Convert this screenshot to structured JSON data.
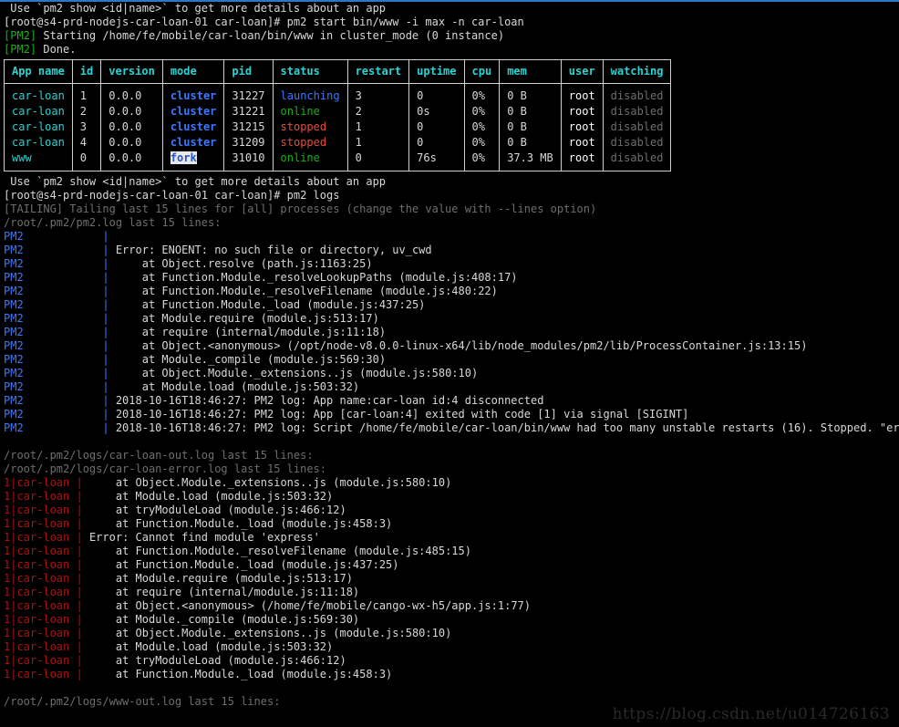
{
  "terminal": {
    "hint_line": " Use `pm2 show <id|name>` to get more details about an app",
    "prompt_1_user": "[root@s4-prd-nodejs-car-loan-01 car-loan]#",
    "prompt_1_cmd": " pm2 start bin/www -i max -n car-loan",
    "pm2_tag": "[PM2]",
    "starting_text": " Starting /home/fe/mobile/car-loan/bin/www in cluster_mode (0 instance)",
    "done_text": " Done.",
    "hint_line_2": " Use `pm2 show <id|name>` to get more details about an app",
    "prompt_2_user": "[root@s4-prd-nodejs-car-loan-01 car-loan]#",
    "prompt_2_cmd": " pm2 logs",
    "tailing_line": "[TAILING] Tailing last 15 lines for [all] processes (change the value with --lines option)",
    "pm2log_header": "/root/.pm2/pm2.log last 15 lines:",
    "carloan_out_header": "/root/.pm2/logs/car-loan-out.log last 15 lines:",
    "carloan_err_header": "/root/.pm2/logs/car-loan-error.log last 15 lines:",
    "www_out_header": "/root/.pm2/logs/www-out.log last 15 lines:"
  },
  "table": {
    "headers": [
      "App name",
      "id",
      "version",
      "mode",
      "pid",
      "status",
      "restart",
      "uptime",
      "cpu",
      "mem",
      "user",
      "watching"
    ],
    "rows": [
      {
        "app": "car-loan",
        "id": "1",
        "version": "0.0.0",
        "mode": "cluster",
        "mode_selected": false,
        "pid": "31227",
        "status": "launching",
        "status_kind": "launching",
        "restart": "3",
        "uptime": "0",
        "cpu": "0%",
        "mem": "0 B",
        "user": "root",
        "watching": "disabled"
      },
      {
        "app": "car-loan",
        "id": "2",
        "version": "0.0.0",
        "mode": "cluster",
        "mode_selected": false,
        "pid": "31221",
        "status": "online",
        "status_kind": "online",
        "restart": "2",
        "uptime": "0s",
        "cpu": "0%",
        "mem": "0 B",
        "user": "root",
        "watching": "disabled"
      },
      {
        "app": "car-loan",
        "id": "3",
        "version": "0.0.0",
        "mode": "cluster",
        "mode_selected": false,
        "pid": "31215",
        "status": "stopped",
        "status_kind": "stopped",
        "restart": "1",
        "uptime": "0",
        "cpu": "0%",
        "mem": "0 B",
        "user": "root",
        "watching": "disabled"
      },
      {
        "app": "car-loan",
        "id": "4",
        "version": "0.0.0",
        "mode": "cluster",
        "mode_selected": false,
        "pid": "31209",
        "status": "stopped",
        "status_kind": "stopped",
        "restart": "1",
        "uptime": "0",
        "cpu": "0%",
        "mem": "0 B",
        "user": "root",
        "watching": "disabled"
      },
      {
        "app": "www",
        "id": "0",
        "version": "0.0.0",
        "mode": "fork",
        "mode_selected": true,
        "pid": "31010",
        "status": "online",
        "status_kind": "online",
        "restart": "0",
        "uptime": "76s",
        "cpu": "0%",
        "mem": "37.3 MB",
        "user": "root",
        "watching": "disabled"
      }
    ]
  },
  "pm2_log_lines": [
    {
      "tag": "PM2",
      "bar": "|",
      "text": ""
    },
    {
      "tag": "PM2",
      "bar": "|",
      "text": " Error: ENOENT: no such file or directory, uv_cwd"
    },
    {
      "tag": "PM2",
      "bar": "|",
      "text": "     at Object.resolve (path.js:1163:25)"
    },
    {
      "tag": "PM2",
      "bar": "|",
      "text": "     at Function.Module._resolveLookupPaths (module.js:408:17)"
    },
    {
      "tag": "PM2",
      "bar": "|",
      "text": "     at Function.Module._resolveFilename (module.js:480:22)"
    },
    {
      "tag": "PM2",
      "bar": "|",
      "text": "     at Function.Module._load (module.js:437:25)"
    },
    {
      "tag": "PM2",
      "bar": "|",
      "text": "     at Module.require (module.js:513:17)"
    },
    {
      "tag": "PM2",
      "bar": "|",
      "text": "     at require (internal/module.js:11:18)"
    },
    {
      "tag": "PM2",
      "bar": "|",
      "text": "     at Object.<anonymous> (/opt/node-v8.0.0-linux-x64/lib/node_modules/pm2/lib/ProcessContainer.js:13:15)"
    },
    {
      "tag": "PM2",
      "bar": "|",
      "text": "     at Module._compile (module.js:569:30)"
    },
    {
      "tag": "PM2",
      "bar": "|",
      "text": "     at Object.Module._extensions..js (module.js:580:10)"
    },
    {
      "tag": "PM2",
      "bar": "|",
      "text": "     at Module.load (module.js:503:32)"
    },
    {
      "tag": "PM2",
      "bar": "|",
      "text": " 2018-10-16T18:46:27: PM2 log: App name:car-loan id:4 disconnected"
    },
    {
      "tag": "PM2",
      "bar": "|",
      "text": " 2018-10-16T18:46:27: PM2 log: App [car-loan:4] exited with code [1] via signal [SIGINT]"
    },
    {
      "tag": "PM2",
      "bar": "|",
      "text": " 2018-10-16T18:46:27: PM2 log: Script /home/fe/mobile/car-loan/bin/www had too many unstable restarts (16). Stopped. \"errored\""
    }
  ],
  "carloan_error_lines": [
    {
      "tag": "1|car-loan ",
      "bar": "|",
      "text": "     at Object.Module._extensions..js (module.js:580:10)"
    },
    {
      "tag": "1|car-loan ",
      "bar": "|",
      "text": "     at Module.load (module.js:503:32)"
    },
    {
      "tag": "1|car-loan ",
      "bar": "|",
      "text": "     at tryModuleLoad (module.js:466:12)"
    },
    {
      "tag": "1|car-loan ",
      "bar": "|",
      "text": "     at Function.Module._load (module.js:458:3)"
    },
    {
      "tag": "1|car-loan ",
      "bar": "|",
      "text": " Error: Cannot find module 'express'"
    },
    {
      "tag": "1|car-loan ",
      "bar": "|",
      "text": "     at Function.Module._resolveFilename (module.js:485:15)"
    },
    {
      "tag": "1|car-loan ",
      "bar": "|",
      "text": "     at Function.Module._load (module.js:437:25)"
    },
    {
      "tag": "1|car-loan ",
      "bar": "|",
      "text": "     at Module.require (module.js:513:17)"
    },
    {
      "tag": "1|car-loan ",
      "bar": "|",
      "text": "     at require (internal/module.js:11:18)"
    },
    {
      "tag": "1|car-loan ",
      "bar": "|",
      "text": "     at Object.<anonymous> (/home/fe/mobile/cango-wx-h5/app.js:1:77)"
    },
    {
      "tag": "1|car-loan ",
      "bar": "|",
      "text": "     at Module._compile (module.js:569:30)"
    },
    {
      "tag": "1|car-loan ",
      "bar": "|",
      "text": "     at Object.Module._extensions..js (module.js:580:10)"
    },
    {
      "tag": "1|car-loan ",
      "bar": "|",
      "text": "     at Module.load (module.js:503:32)"
    },
    {
      "tag": "1|car-loan ",
      "bar": "|",
      "text": "     at tryModuleLoad (module.js:466:12)"
    },
    {
      "tag": "1|car-loan ",
      "bar": "|",
      "text": "     at Function.Module._load (module.js:458:3)"
    }
  ],
  "watermark": "https://blog.csdn.net/u014726163",
  "colors": {
    "background": "#000000",
    "foreground": "#d8d8d8",
    "green": "#18b218",
    "cyan": "#29d3d3",
    "blue": "#3b78ff",
    "red": "#e74c3c",
    "dark_red": "#b01010",
    "gray": "#6e6e6e",
    "window_border": "#2878c8"
  }
}
